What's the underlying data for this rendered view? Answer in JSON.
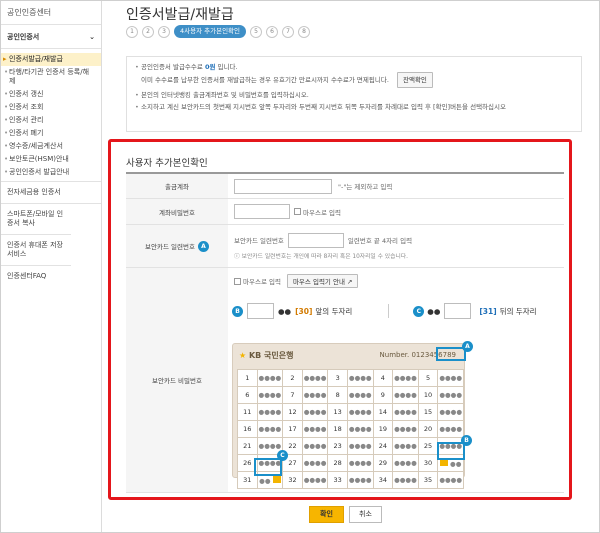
{
  "sidebar": {
    "title": "공인인증센터",
    "selected": "공인인증서",
    "items": [
      "인증서발급/재발급",
      "타행/타기관 인증서 등록/해제",
      "인증서 갱신",
      "인증서 조회",
      "인증서 관리",
      "인증서 폐기",
      "영수증/세금계산서",
      "보안토큰(HSM)안내",
      "공인인증서 발급안내"
    ],
    "links": [
      "전자세금용 인증서",
      "스마트폰/모바일 인증서 복사",
      "인증서 휴대폰 저장서비스",
      "인증센터FAQ"
    ]
  },
  "header": {
    "title": "인증서발급/재발급",
    "steps": [
      "1",
      "2",
      "3"
    ],
    "current_step": "4사용자 추가본인확인",
    "steps_after": [
      "5",
      "6",
      "7",
      "8"
    ]
  },
  "notice": {
    "line1_a": "공인인증서 발급수수료",
    "line1_fee": "0원",
    "line1_b": "입니다.",
    "line2": "이미 수수료를 납부한 인증서를 재발급하는 경우 유효기간 만료시까지 수수료가 면제됩니다.",
    "line2_btn": "잔액확인",
    "line3": "본인의 인터넷뱅킹 출금계좌번호 및 비밀번호를 입력하십시오.",
    "line4": "소지하고 계신 보안카드의 첫번째 지시번호 앞쪽 두자리와 두번째 지시번호 뒤쪽 두자리를 차례대로 입력 후 [확인]버튼을 선택하십시오"
  },
  "section_title": "사용자 추가본인확인",
  "form": {
    "account_label": "출금계좌",
    "account_hint": "\"-\"는 제외하고 입력",
    "password_label": "계좌비밀번호",
    "mouse_input": "마우스로 입력",
    "serial_label": "보안카드 일련번호",
    "serial_text": "보안카드 일련번호",
    "serial_hint": "일련번호 끝 4자리 입력",
    "serial_note": "보안카드 일련번호는 개인에 따라 8자리 혹은 10자리일 수 있습니다.",
    "card_pw_label": "보안카드 비밀번호",
    "mouse_guide": "마우스 입력기 안내",
    "front_num": "[30]",
    "front_text": "앞의 두자리",
    "back_num": "[31]",
    "back_text": "뒤의 두자리",
    "dots": "●●"
  },
  "card": {
    "bank": "KB 국민은행",
    "number_label": "Number.",
    "number": "0123456789",
    "cells": [
      [
        "1",
        "2",
        "3",
        "4",
        "5"
      ],
      [
        "6",
        "7",
        "8",
        "9",
        "10"
      ],
      [
        "11",
        "12",
        "13",
        "14",
        "15"
      ],
      [
        "16",
        "17",
        "18",
        "19",
        "20"
      ],
      [
        "21",
        "22",
        "23",
        "24",
        "25"
      ],
      [
        "26",
        "27",
        "28",
        "29",
        "30"
      ],
      [
        "31",
        "32",
        "33",
        "34",
        "35"
      ]
    ],
    "masked": "●●●●"
  },
  "buttons": {
    "ok": "확인",
    "cancel": "취소"
  },
  "badges": {
    "a": "A",
    "b": "B",
    "c": "C"
  }
}
